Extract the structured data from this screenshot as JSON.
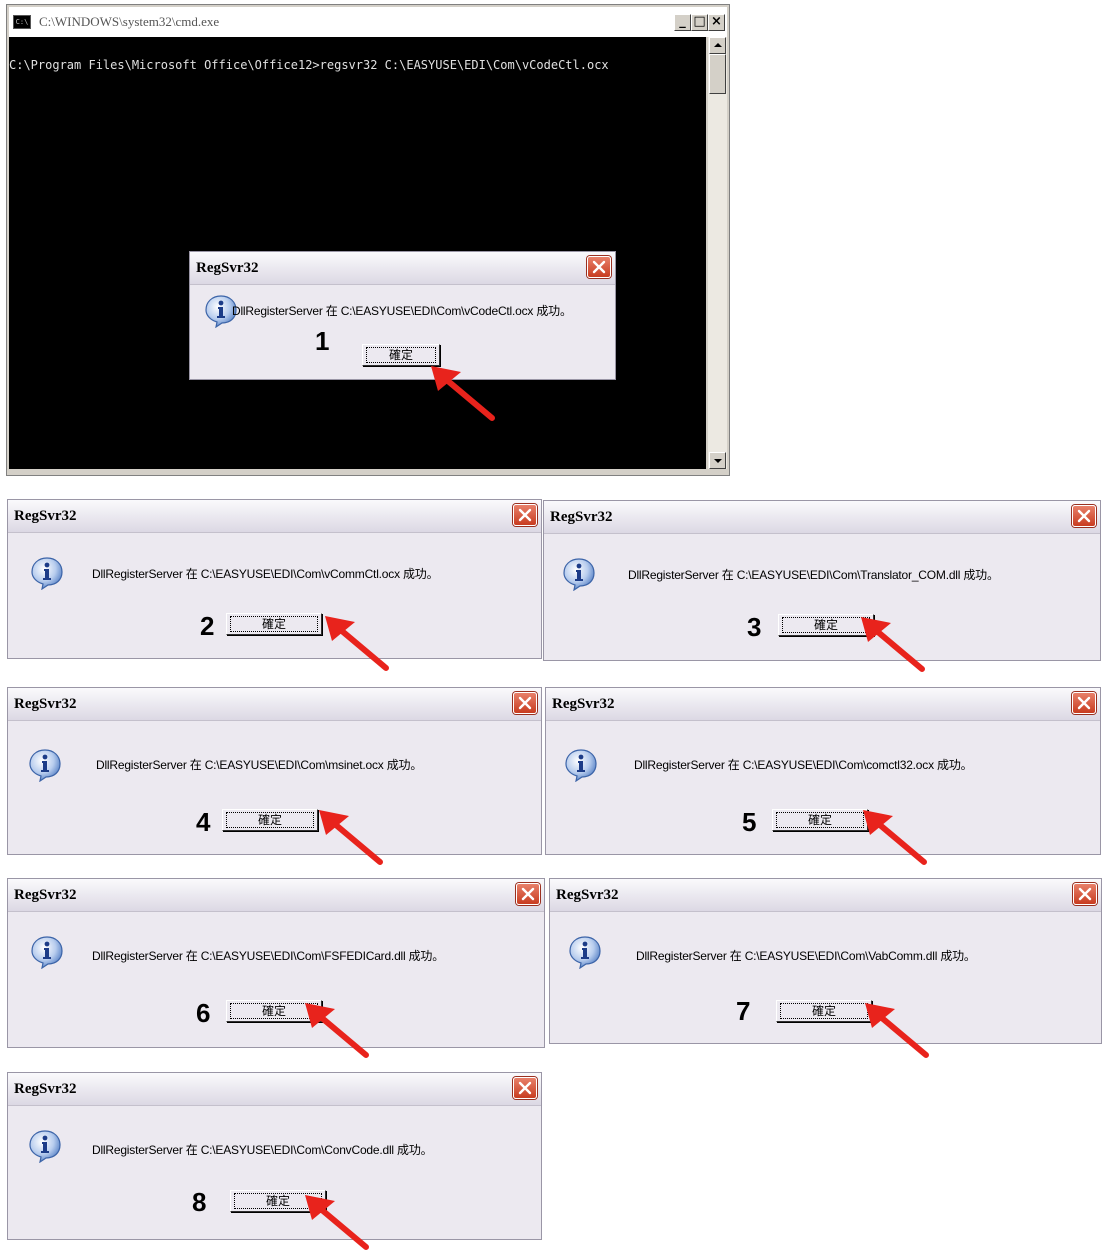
{
  "cmd": {
    "title": "C:\\WINDOWS\\system32\\cmd.exe",
    "icon_label": "C:\\",
    "line": "C:\\Program Files\\Microsoft Office\\Office12>regsvr32 C:\\EASYUSE\\EDI\\Com\\vCodeCtl.ocx",
    "controls": {
      "minimize": "_",
      "maximize": "□",
      "close": "×"
    }
  },
  "dialog_title": "RegSvr32",
  "ok_label": "確定",
  "dialogs": [
    {
      "step": "1",
      "message": "DllRegisterServer 在 C:\\EASYUSE\\EDI\\Com\\vCodeCtl.ocx 成功。"
    },
    {
      "step": "2",
      "message": "DllRegisterServer 在 C:\\EASYUSE\\EDI\\Com\\vCommCtl.ocx 成功。"
    },
    {
      "step": "3",
      "message": "DllRegisterServer 在 C:\\EASYUSE\\EDI\\Com\\Translator_COM.dll 成功。"
    },
    {
      "step": "4",
      "message": "DllRegisterServer 在 C:\\EASYUSE\\EDI\\Com\\msinet.ocx 成功。"
    },
    {
      "step": "5",
      "message": "DllRegisterServer 在 C:\\EASYUSE\\EDI\\Com\\comctl32.ocx 成功。"
    },
    {
      "step": "6",
      "message": "DllRegisterServer 在 C:\\EASYUSE\\EDI\\Com\\FSFEDICard.dll 成功。"
    },
    {
      "step": "7",
      "message": "DllRegisterServer 在 C:\\EASYUSE\\EDI\\Com\\VabComm.dll 成功。"
    },
    {
      "step": "8",
      "message": "DllRegisterServer 在 C:\\EASYUSE\\EDI\\Com\\ConvCode.dll 成功。"
    }
  ],
  "colors": {
    "arrow": "#e8231c",
    "console_bg": "#000000",
    "dialog_bg": "#ece9f0"
  },
  "icons": {
    "info": "info-icon",
    "close": "close-icon",
    "arrow": "red-arrow-icon"
  }
}
